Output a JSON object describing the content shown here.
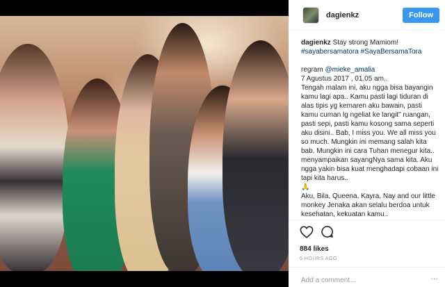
{
  "post": {
    "username": "dagienkz",
    "follow_label": "Follow",
    "caption_user": "dagienkz",
    "caption_text": "Stay strong Mamiom!",
    "hashtags": "#sayabersamatora #SayaBersamaTora",
    "regram_prefix": "regram",
    "regram_user": "@mieke_amalia",
    "date_line": "7 Agustus 2017 , 01.05 am..",
    "body_text": "Tengah malam ini, aku ngga bisa bayangin kamu lagi apa.. Kamu pasti lagi tiduran di alas tipis yg kemaren aku bawain, pasti kamu cuman lg ngeliat ke langit\" ruangan, pasti sepi, pasti kamu kosong sama seperti aku disini.. Bab, I miss you. We all miss you so much. Mungkin ini memang salah kita bab. Mungkin ini cara Tuhan menegur kita.. menyampaikan sayangNya sama kita. Aku ngga yakin bisa kuat menghadapi cobaan ini tapi kita harus..",
    "prayer_emoji": "🙏",
    "body_text_2": "Aku, Bila, Queena, Kayra, Nay and our little monkey Jenaka akan selalu berdoa untuk kesehatan, kekuatan kamu.. ",
    "likes": "884 likes",
    "time_ago": "6 HOURS AGO",
    "comment_placeholder": "Add a comment...",
    "more_dots": "..."
  },
  "icons": {
    "like": "heart-outline-icon",
    "comment": "speech-bubble-icon",
    "more": "more-dots-icon"
  },
  "colors": {
    "follow_button": "#3897f0",
    "hashtag": "#003569",
    "muted": "#999999"
  }
}
